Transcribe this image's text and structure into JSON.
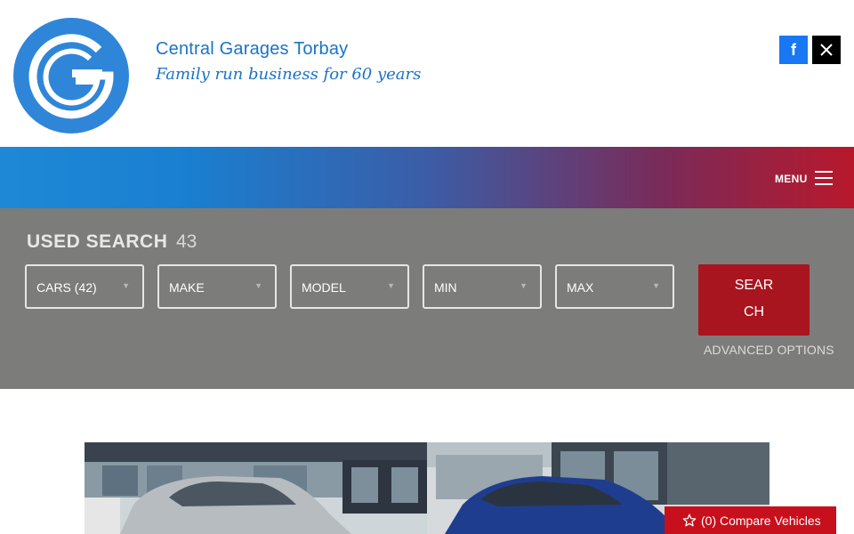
{
  "brand": {
    "title": "Central Garages Torbay",
    "tagline": "Family run business for 60 years"
  },
  "header": {
    "social": [
      {
        "name": "facebook",
        "icon": "facebook-icon",
        "glyph": "f",
        "color": "#1877f2"
      },
      {
        "name": "x",
        "icon": "x-icon",
        "glyph": "𝕏",
        "color": "#000000"
      }
    ]
  },
  "nav": {
    "menu_label": "MENU",
    "gradient": [
      "#1e88d6",
      "#3b5da6",
      "#b8182c"
    ]
  },
  "search": {
    "title": "USED SEARCH",
    "count": "43",
    "selects": [
      {
        "label": "CARS (42)"
      },
      {
        "label": "MAKE"
      },
      {
        "label": "MODEL"
      },
      {
        "label": "MIN"
      },
      {
        "label": "MAX"
      }
    ],
    "button_line1": "SEAR",
    "button_line2": "CH",
    "advanced_label": "ADVANCED OPTIONS"
  },
  "compare": {
    "label": "(0) Compare Vehicles",
    "icon": "star-outline-icon"
  },
  "colors": {
    "brand_blue": "#1a73c7",
    "panel_gray": "#7c7c7a",
    "button_red": "#a8151f",
    "compare_red": "#c8101c"
  }
}
